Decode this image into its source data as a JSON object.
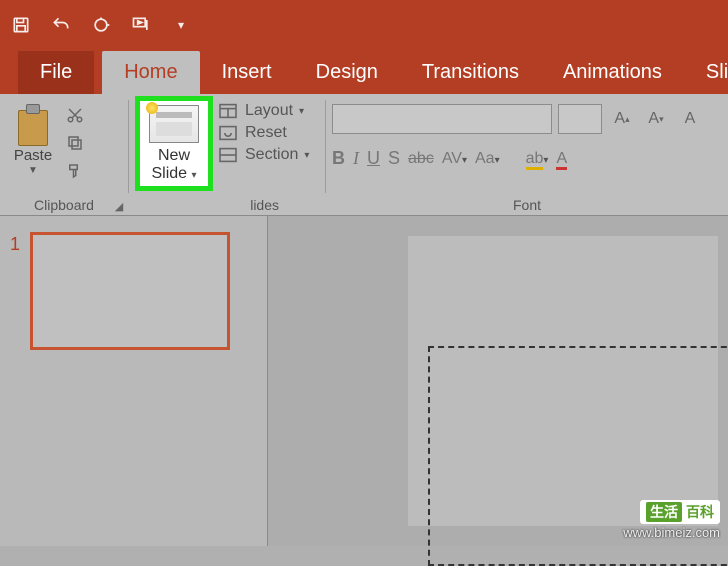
{
  "qat": {
    "save": "save",
    "undo": "undo",
    "redo": "redo",
    "present": "present"
  },
  "tabs": {
    "file": "File",
    "home": "Home",
    "insert": "Insert",
    "design": "Design",
    "transitions": "Transitions",
    "animations": "Animations",
    "slideshow": "Slide"
  },
  "ribbon": {
    "clipboard": {
      "paste": "Paste",
      "label": "Clipboard"
    },
    "slides": {
      "new_slide": "New\nSlide",
      "layout": "Layout",
      "reset": "Reset",
      "section": "Section",
      "label": "lides"
    },
    "font": {
      "label": "Font",
      "bold": "B",
      "italic": "I",
      "underline": "U",
      "shadow": "S",
      "strike": "abc",
      "spacing": "AV",
      "case": "Aa",
      "highlight": "ab",
      "increase": "A",
      "decrease": "A",
      "clear": "A"
    }
  },
  "panel": {
    "slide_number": "1"
  },
  "watermark": {
    "brand_left": "生活",
    "brand_right": "百科",
    "url": "www.bimeiz.com"
  }
}
